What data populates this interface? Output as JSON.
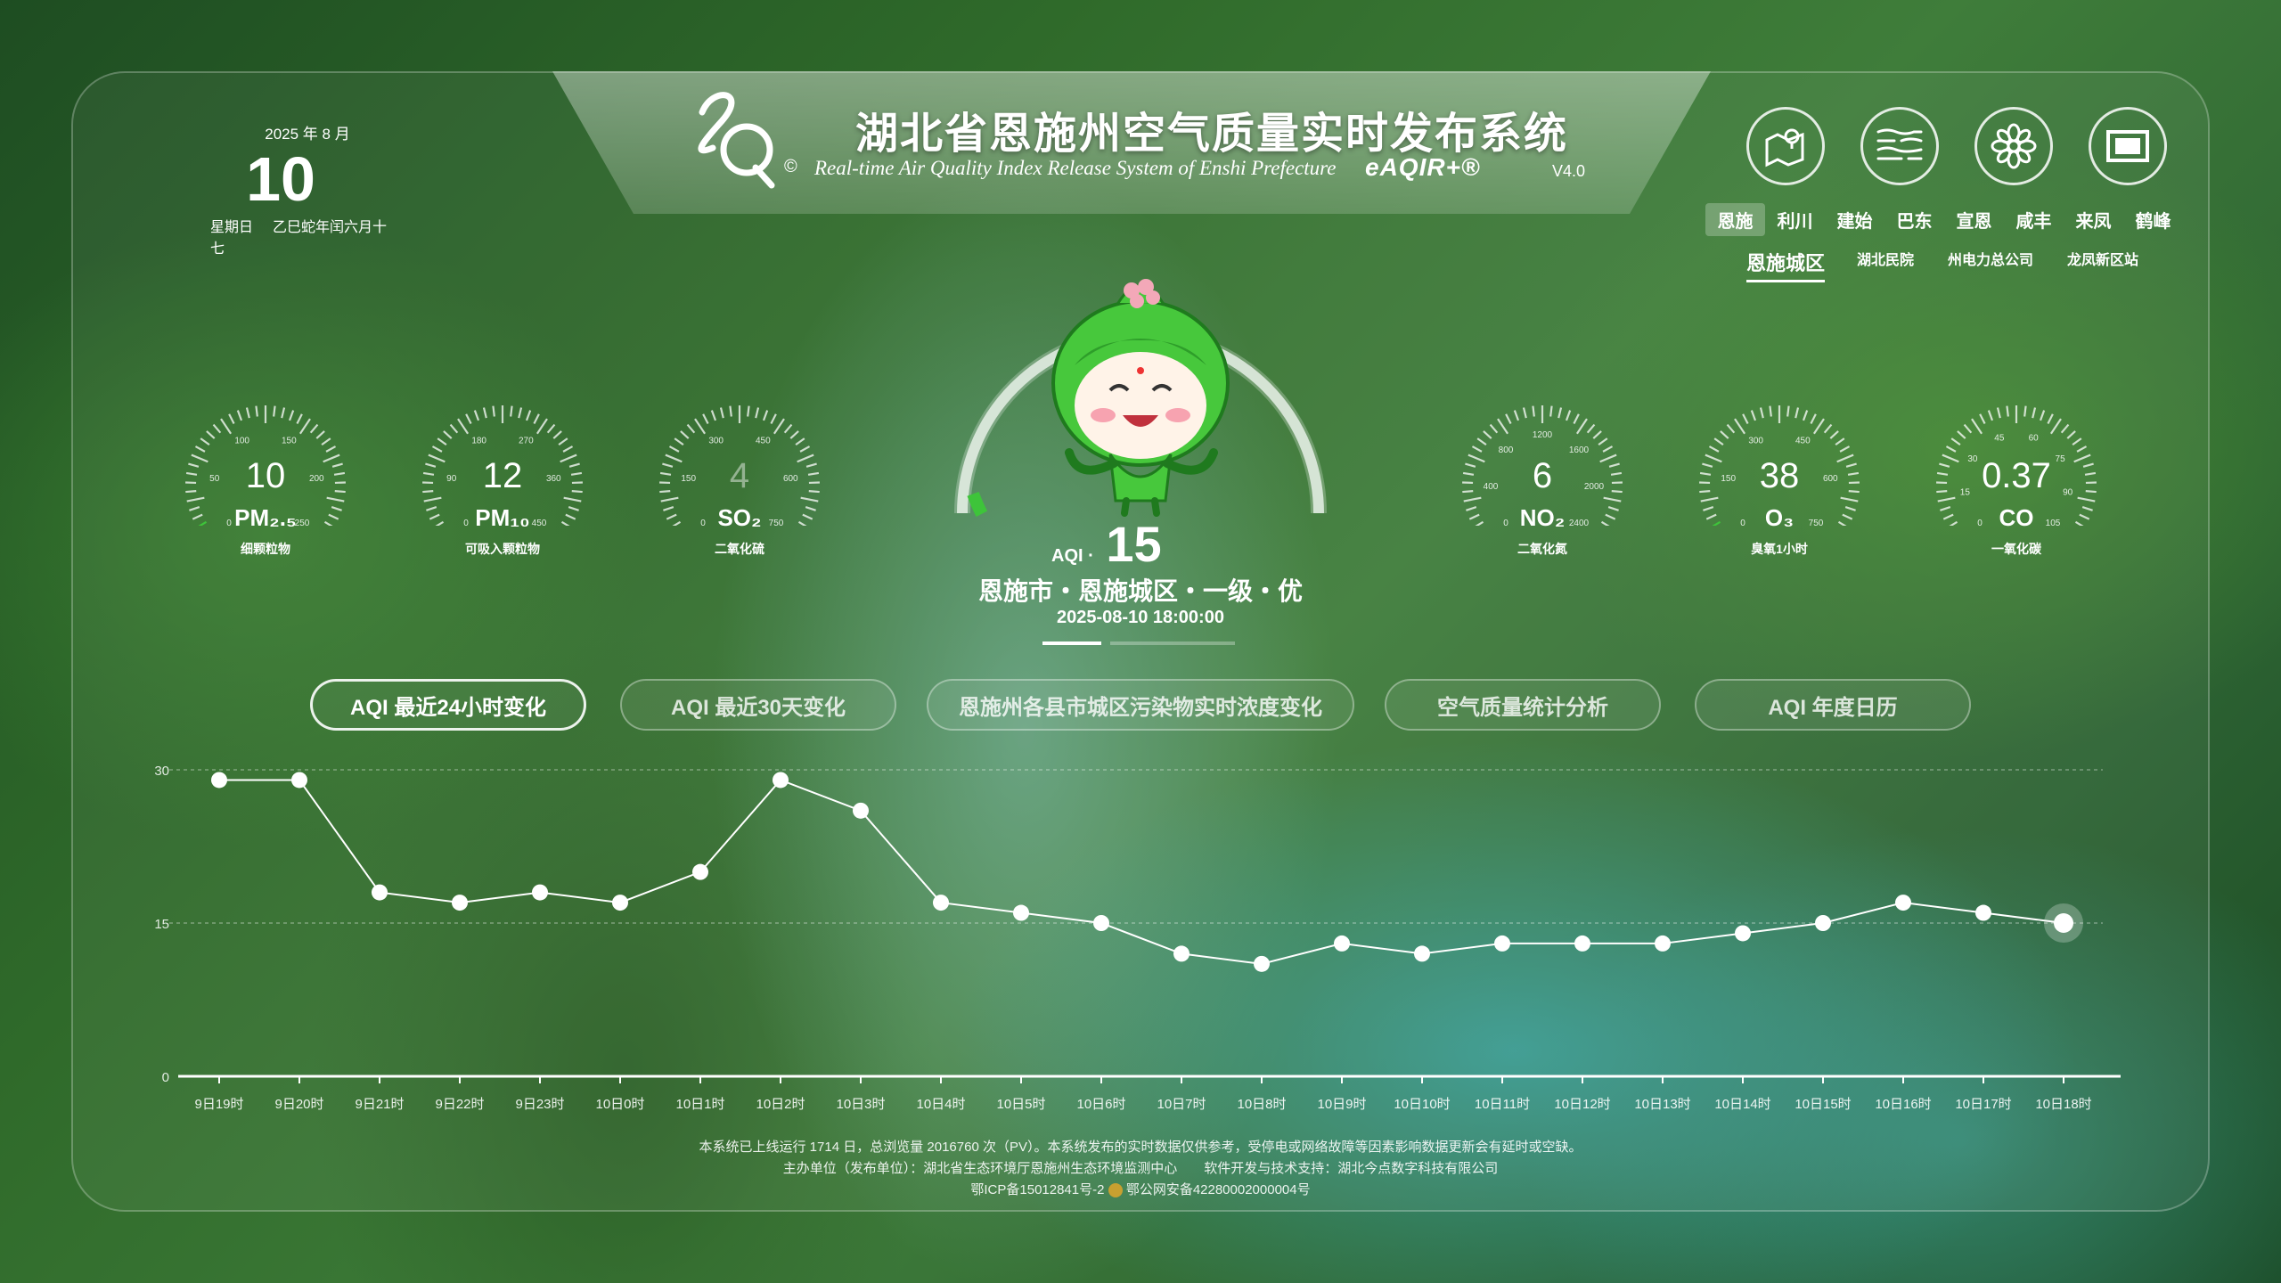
{
  "header": {
    "title": "湖北省恩施州空气质量实时发布系统",
    "subtitle": "Real-time Air Quality Index Release System of Enshi Prefecture",
    "copyright_symbol": "©",
    "brand": "eAQIR+®",
    "version": "V4.0"
  },
  "date": {
    "year_month": "2025 年 8 月",
    "day": "10",
    "weekday": "星期日",
    "lunar": "乙巳蛇年闰六月十七"
  },
  "toolbar": {
    "icons": [
      "map-pin-icon",
      "haze-icon",
      "flower-icon",
      "fullscreen-icon"
    ]
  },
  "cities": [
    "恩施",
    "利川",
    "建始",
    "巴东",
    "宣恩",
    "咸丰",
    "来凤",
    "鹤峰"
  ],
  "stations": [
    "恩施城区",
    "湖北民院",
    "州电力总公司",
    "龙凤新区站"
  ],
  "pollutants_left": [
    {
      "value": "10",
      "name": "PM₂.₅",
      "cn": "细颗粒物",
      "ticks": [
        "0",
        "50",
        "100",
        "150",
        "200",
        "250"
      ],
      "level": 0.04
    },
    {
      "value": "12",
      "name": "PM₁₀",
      "cn": "可吸入颗粒物",
      "ticks": [
        "0",
        "90",
        "180",
        "270",
        "360",
        "450"
      ],
      "level": 0.03
    },
    {
      "value": "4",
      "name": "SO₂",
      "cn": "二氧化硫",
      "ticks": [
        "0",
        "150",
        "300",
        "450",
        "600",
        "750"
      ],
      "level": 0.01
    }
  ],
  "pollutants_right": [
    {
      "value": "6",
      "name": "NO₂",
      "cn": "二氧化氮",
      "ticks": [
        "0",
        "400",
        "800",
        "1200",
        "1600",
        "2000",
        "2400"
      ],
      "level": 0.01
    },
    {
      "value": "38",
      "name": "O₃",
      "cn": "臭氧1小时",
      "ticks": [
        "0",
        "150",
        "300",
        "450",
        "600",
        "750"
      ],
      "level": 0.05
    },
    {
      "value": "0.37",
      "name": "CO",
      "cn": "一氧化碳",
      "ticks": [
        "0",
        "15",
        "30",
        "45",
        "60",
        "75",
        "90",
        "105"
      ],
      "level": 0.01
    }
  ],
  "aqi": {
    "label": "AQI",
    "value": "15",
    "description": "恩施市・恩施城区・一级・优",
    "timestamp": "2025-08-10 18:00:00",
    "level": 0.03
  },
  "tabs": [
    "AQI 最近24小时变化",
    "AQI 最近30天变化",
    "恩施州各县市城区污染物实时浓度变化",
    "空气质量统计分析",
    "AQI 年度日历"
  ],
  "chart_data": {
    "type": "line",
    "x": [
      "9日19时",
      "9日20时",
      "9日21时",
      "9日22时",
      "9日23时",
      "10日0时",
      "10日1时",
      "10日2时",
      "10日3时",
      "10日4时",
      "10日5时",
      "10日6时",
      "10日7时",
      "10日8时",
      "10日9时",
      "10日10时",
      "10日11时",
      "10日12时",
      "10日13时",
      "10日14时",
      "10日15时",
      "10日16时",
      "10日17时",
      "10日18时"
    ],
    "values": [
      29,
      29,
      18,
      17,
      18,
      17,
      20,
      29,
      26,
      17,
      16,
      15,
      12,
      11,
      13,
      12,
      13,
      13,
      13,
      14,
      15,
      17,
      16,
      15
    ],
    "yticks": [
      "0",
      "15",
      "30"
    ],
    "ylim": [
      0,
      30
    ],
    "color": "#ffffff"
  },
  "footer": {
    "line1": "本系统已上线运行 1714 日，总浏览量 2016760 次（PV）。本系统发布的实时数据仅供参考，受停电或网络故障等因素影响数据更新会有延时或空缺。",
    "line2_a": "主办单位（发布单位）：湖北省生态环境厅恩施州生态环境监测中心",
    "line2_b": "软件开发与技术支持：湖北今点数字科技有限公司",
    "icp": "鄂ICP备15012841号-2",
    "police": "鄂公网安备42280002000004号"
  }
}
